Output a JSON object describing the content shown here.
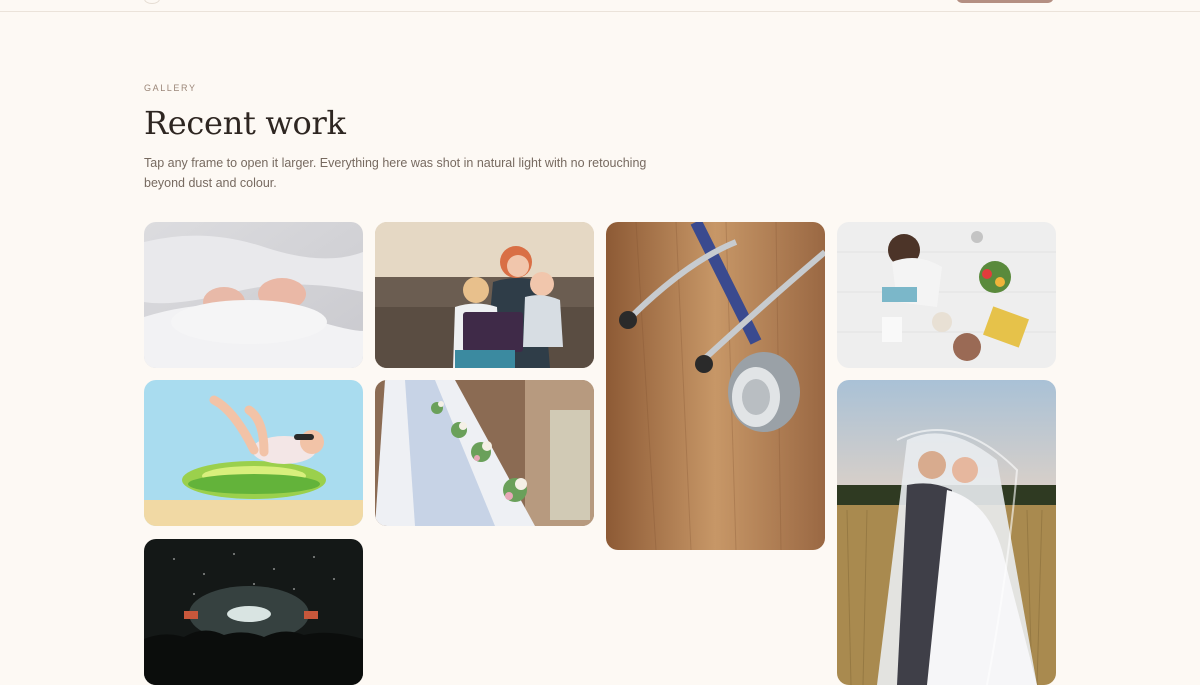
{
  "header": {
    "eyebrow": "GALLERY",
    "title": "Recent work",
    "intro": "Tap any frame to open it larger. Everything here was shot in natural light with no retouching beyond dust and colour."
  },
  "colors": {
    "background": "#fdf9f4",
    "accent": "#b48f82",
    "heading": "#2e2621",
    "body_text": "#776a60"
  },
  "gallery": {
    "items": [
      {
        "subject": "newborn-feet"
      },
      {
        "subject": "mother-with-children"
      },
      {
        "subject": "stethoscope"
      },
      {
        "subject": "toddler-with-toys"
      },
      {
        "subject": "baby-in-pool-float"
      },
      {
        "subject": "wedding-table"
      },
      {
        "subject": "wedding-couple-veil"
      },
      {
        "subject": "concert-crowd"
      }
    ]
  }
}
